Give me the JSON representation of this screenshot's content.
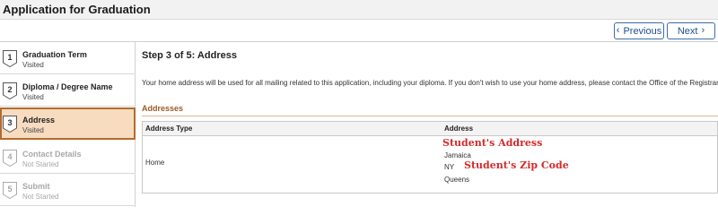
{
  "header": {
    "title": "Application for Graduation"
  },
  "nav": {
    "previous_label": "Previous",
    "next_label": "Next"
  },
  "steps": [
    {
      "number": "1",
      "label": "Graduation Term",
      "status": "Visited"
    },
    {
      "number": "2",
      "label": "Diploma / Degree Name",
      "status": "Visited"
    },
    {
      "number": "3",
      "label": "Address",
      "status": "Visited"
    },
    {
      "number": "4",
      "label": "Contact Details",
      "status": "Not Started"
    },
    {
      "number": "5",
      "label": "Submit",
      "status": "Not Started"
    }
  ],
  "main": {
    "step_heading": "Step 3 of 5: Address",
    "intro": "Your home address will be used for all mailing related to this application, including your diploma. If you don't wish to use your home address, please contact the Office of the Registrar.",
    "section_title": "Addresses",
    "table": {
      "headers": {
        "type": "Address Type",
        "address": "Address"
      },
      "row": {
        "type": "Home",
        "address_overlay": "Student's Address",
        "city": "Jamaica",
        "state": "NY",
        "zip_overlay": "Student's Zip Code",
        "county": "Queens"
      }
    }
  },
  "colors": {
    "active_step_bg": "#f8dcc0",
    "active_step_border": "#b36b2e",
    "section_title": "#9a5a27",
    "overlay_red": "#d42a2a",
    "button_border": "#3d6ea8"
  }
}
